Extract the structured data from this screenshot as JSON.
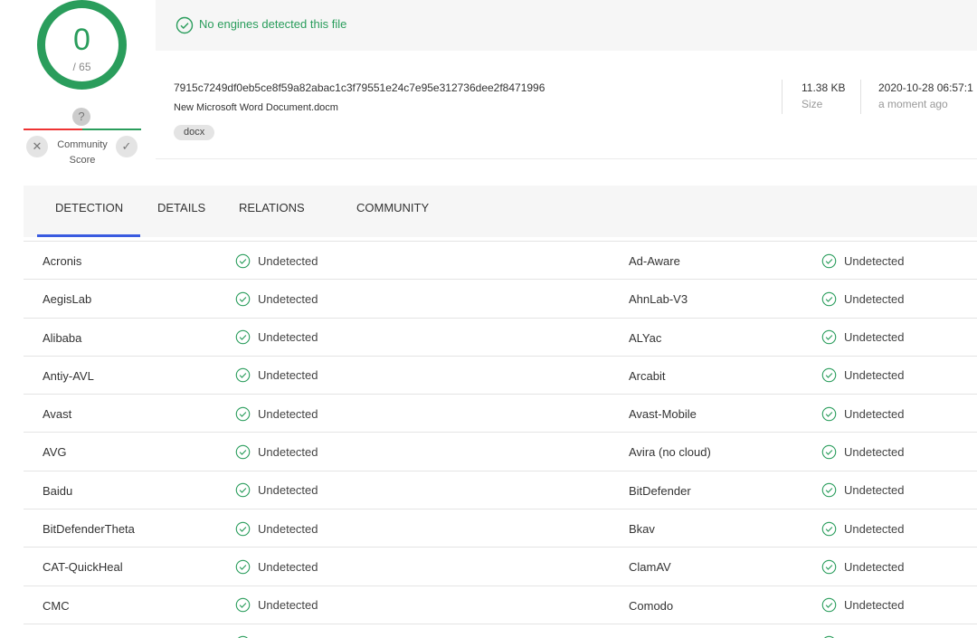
{
  "score": {
    "detected": "0",
    "total": "/ 65"
  },
  "community": {
    "question": "?",
    "label_line1": "Community",
    "label_line2": "Score",
    "down": "✕",
    "up": "✓"
  },
  "banner": {
    "text": "No engines detected this file"
  },
  "file": {
    "hash": "7915c7249df0eb5ce8f59a82abac1c3f79551e24c7e95e312736dee2f8471996",
    "name": "New Microsoft Word Document.docm",
    "tag": "docx",
    "size_value": "11.38 KB",
    "size_label": "Size",
    "date_value": "2020-10-28 06:57:1",
    "date_label": "a moment ago"
  },
  "tabs": [
    "DETECTION",
    "DETAILS",
    "RELATIONS",
    "COMMUNITY"
  ],
  "colors": {
    "clean": "#2a9d5c",
    "tab_accent": "#3a5be0",
    "negative": "#e33"
  },
  "detections": [
    {
      "left": {
        "engine": "Acronis",
        "result": "Undetected"
      },
      "right": {
        "engine": "Ad-Aware",
        "result": "Undetected"
      }
    },
    {
      "left": {
        "engine": "AegisLab",
        "result": "Undetected"
      },
      "right": {
        "engine": "AhnLab-V3",
        "result": "Undetected"
      }
    },
    {
      "left": {
        "engine": "Alibaba",
        "result": "Undetected"
      },
      "right": {
        "engine": "ALYac",
        "result": "Undetected"
      }
    },
    {
      "left": {
        "engine": "Antiy-AVL",
        "result": "Undetected"
      },
      "right": {
        "engine": "Arcabit",
        "result": "Undetected"
      }
    },
    {
      "left": {
        "engine": "Avast",
        "result": "Undetected"
      },
      "right": {
        "engine": "Avast-Mobile",
        "result": "Undetected"
      }
    },
    {
      "left": {
        "engine": "AVG",
        "result": "Undetected"
      },
      "right": {
        "engine": "Avira (no cloud)",
        "result": "Undetected"
      }
    },
    {
      "left": {
        "engine": "Baidu",
        "result": "Undetected"
      },
      "right": {
        "engine": "BitDefender",
        "result": "Undetected"
      }
    },
    {
      "left": {
        "engine": "BitDefenderTheta",
        "result": "Undetected"
      },
      "right": {
        "engine": "Bkav",
        "result": "Undetected"
      }
    },
    {
      "left": {
        "engine": "CAT-QuickHeal",
        "result": "Undetected"
      },
      "right": {
        "engine": "ClamAV",
        "result": "Undetected"
      }
    },
    {
      "left": {
        "engine": "CMC",
        "result": "Undetected"
      },
      "right": {
        "engine": "Comodo",
        "result": "Undetected"
      }
    }
  ]
}
